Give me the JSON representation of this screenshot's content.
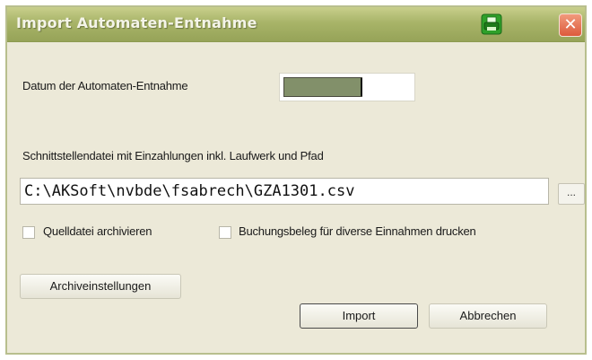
{
  "window": {
    "title": "Import Automaten-Entnahme",
    "close_glyph": "✕",
    "app_icon": "printer-icon",
    "close_icon": "close-icon"
  },
  "form": {
    "date_label": "Datum der Automaten-Entnahme",
    "file_label": "Schnittstellendatei mit Einzahlungen inkl. Laufwerk und Pfad",
    "file_path": "C:\\AKSoft\\nvbde\\fsabrech\\GZA1301.csv",
    "browse_label": "...",
    "archive_checkbox_label": "Quelldatei archivieren",
    "archive_checked": false,
    "print_checkbox_label": "Buchungsbeleg für diverse Einnahmen drucken",
    "print_checked": false
  },
  "buttons": {
    "archive_settings": "Archiveinstellungen",
    "import": "Import",
    "cancel": "Abbrechen"
  },
  "colors": {
    "titlebar": "#a8b468",
    "window_bg": "#ece9d8",
    "close_red": "#dd5a3c"
  }
}
